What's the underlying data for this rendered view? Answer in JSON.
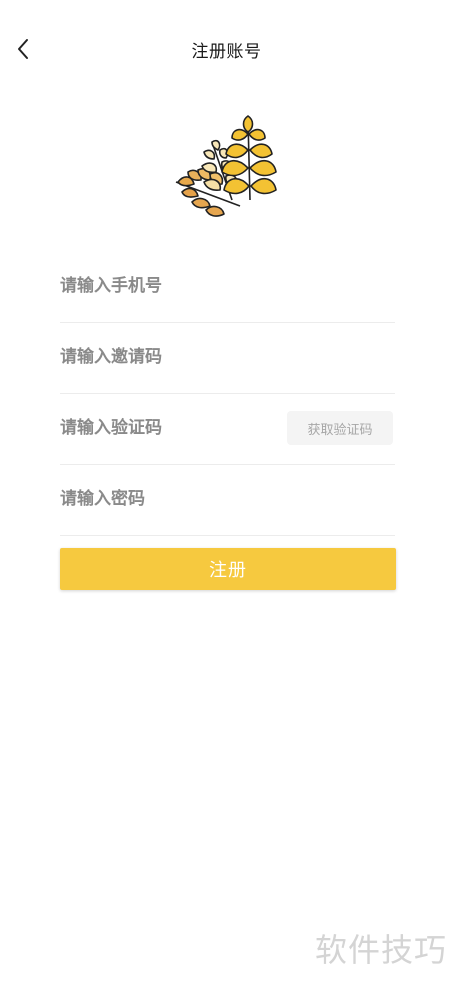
{
  "header": {
    "title": "注册账号",
    "back_icon": "chevron-left-icon"
  },
  "logo": {
    "icon": "wheat-icon",
    "colors": [
      "#f3c233",
      "#e8a94b",
      "#f8e7b8",
      "#222222"
    ]
  },
  "form": {
    "phone_placeholder": "请输入手机号",
    "invite_placeholder": "请输入邀请码",
    "code_placeholder": "请输入验证码",
    "get_code_label": "获取验证码",
    "password_placeholder": "请输入密码"
  },
  "submit": {
    "label": "注册",
    "color": "#f6c93f"
  },
  "watermark": {
    "text": "软件技巧"
  }
}
